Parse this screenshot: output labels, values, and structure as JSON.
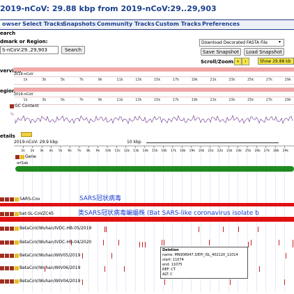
{
  "title": "2019-nCoV: 29.88 kbp from 2019-nCoV:29..29,903",
  "menu": {
    "browser": "owser",
    "select": "Select Tracks",
    "snapshots": "Snapshots",
    "community": "Community Tracks",
    "custom": "Custom Tracks",
    "prefs": "Preferences"
  },
  "search": {
    "heading": "earch",
    "label": "dmark or Region:",
    "value": "S-nCoV:29..29,903",
    "button": "Search"
  },
  "actions": {
    "download": "Download Decorated FASTA File",
    "save": "Save Snapshot",
    "load": "Load Snapshot"
  },
  "scroll": {
    "label": "Scroll/Zoom:",
    "show": "Show 29.88 kb"
  },
  "overview": {
    "label": "verview",
    "name": "2019-nCoV"
  },
  "region": {
    "label": "egion",
    "name": "2019-nCoV",
    "gc": "GC Content"
  },
  "details": {
    "label": "etails",
    "ruler_name": "2019-nCoV: 29.9 kbp",
    "scale": "10 kbp"
  },
  "ticks": [
    "1k",
    "2k",
    "3k",
    "4k",
    "5k",
    "6k",
    "7k",
    "8k",
    "9k",
    "10k",
    "11k",
    "12k",
    "13k",
    "14k",
    "15k",
    "16k",
    "17k",
    "18k",
    "19k",
    "20k",
    "21k",
    "22k",
    "23k",
    "24k",
    "25k",
    "26k",
    "27k",
    "28k",
    "29k"
  ],
  "tracks": [
    {
      "name": "Gene",
      "sub": "orf1ab"
    },
    {
      "name": "SARS-Cov",
      "note": "SARS冠状病毒"
    },
    {
      "name": "bat-SL-CoVZC45",
      "note": "类SARS冠状病毒蝙蝠株 (Bat SARS-like coronavirus isolate b"
    },
    {
      "name": "BetaCoV/Wuhan/IVDC-HB-05/2019"
    },
    {
      "name": "BetaCoV/Wuhan/IVDC-HB-04/2020"
    },
    {
      "name": "BetaCoV/Wuhan/WIV05/2019"
    },
    {
      "name": "BetaCoV/Wuhan/WIV06/2019"
    },
    {
      "name": "BetaCoV/Wuhan/WIV04/2019"
    }
  ],
  "tooltip": {
    "head": "Deletion",
    "name": "name: MN908947.3/EPI_ISL_402120_11014",
    "start": "start: 11074",
    "end": "end: 11075",
    "ref": "REF: CT",
    "alt": "ALT: C"
  },
  "colors": {
    "menu": "#1a3f8f",
    "pink": "#f0a8a8",
    "green": "#1f8a1f",
    "red": "#e01010",
    "blue_note": "#2040d0"
  }
}
